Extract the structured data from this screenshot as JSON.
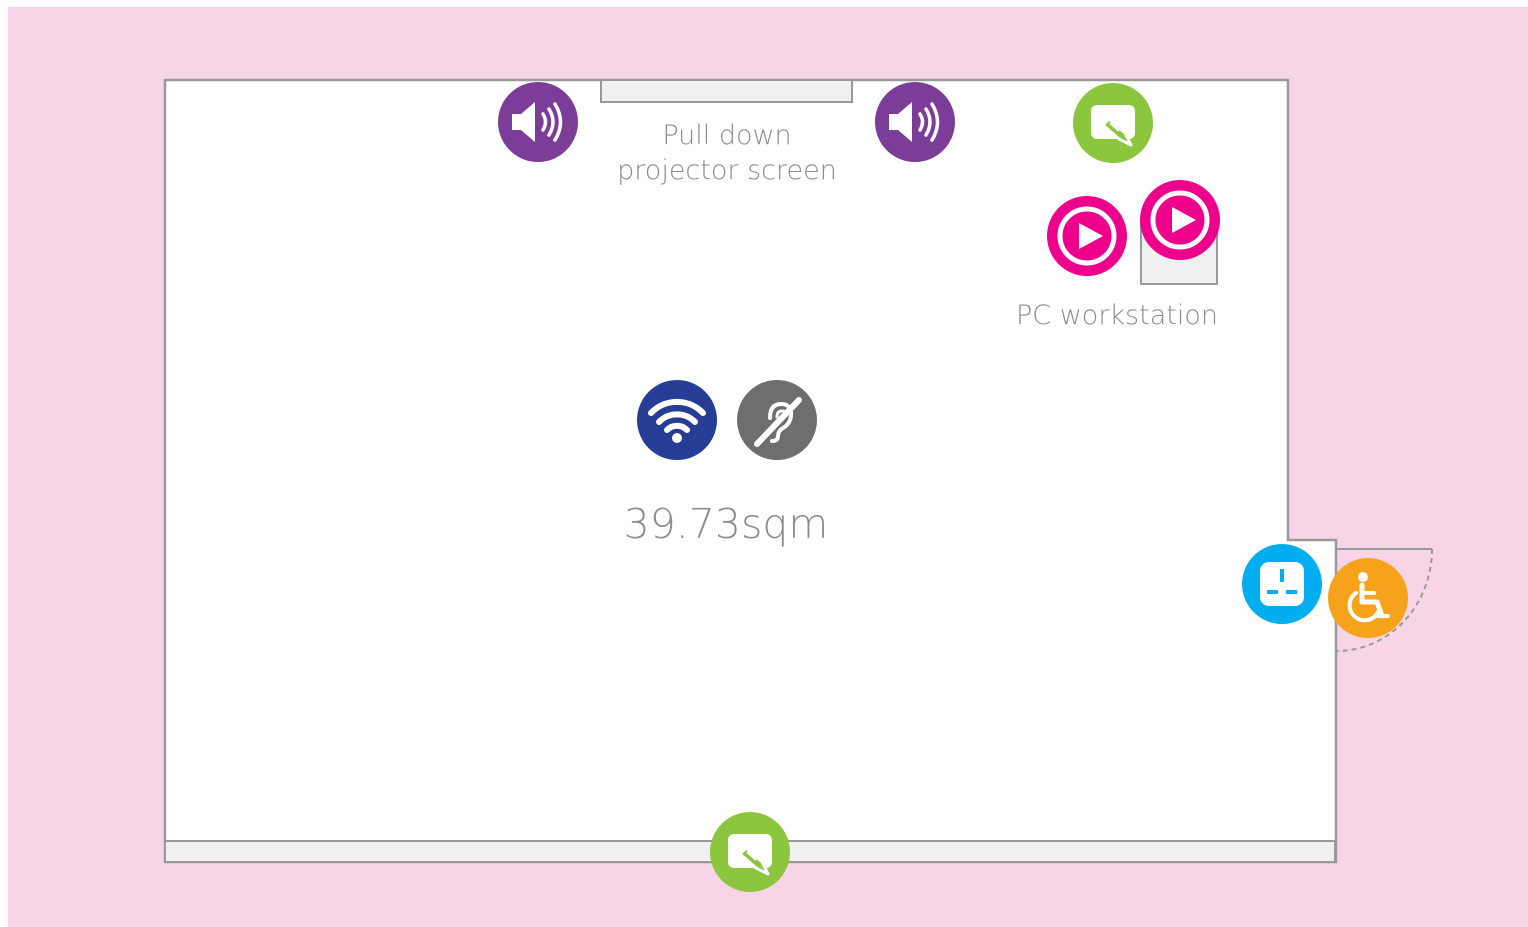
{
  "floorplan": {
    "labels": {
      "projector_screen": "Pull down\nprojector screen",
      "pc_workstation": "PC workstation",
      "area": "39.73sqm"
    },
    "colors": {
      "background": "#f8d5e6",
      "room_fill": "#ffffff",
      "wall": "#999999",
      "fixture_fill": "#f0f0f0",
      "speaker": "#7c3d98",
      "whiteboard": "#8cc63f",
      "media_player": "#ec008c",
      "wifi": "#263d96",
      "hearing_loop": "#6d6e70",
      "power": "#00aeef",
      "accessible": "#f7a21b"
    },
    "icons": [
      "speaker-icon",
      "whiteboard-icon",
      "media-play-icon",
      "wifi-icon",
      "hearing-loop-icon",
      "power-socket-icon",
      "wheelchair-accessible-icon"
    ]
  }
}
